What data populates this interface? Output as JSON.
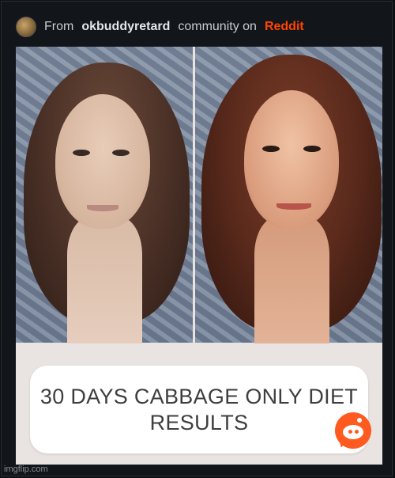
{
  "header": {
    "prefix": "From",
    "community": "okbuddyretard",
    "middle": "community on",
    "brand": "Reddit",
    "avatar_icon": "community-avatar"
  },
  "post": {
    "caption_line1": "30 DAYS CABBAGE ONLY DIET",
    "caption_line2": "RESULTS",
    "badge_icon": "reddit-snoo-icon"
  },
  "watermark": "imgflip.com",
  "colors": {
    "background": "#0e1113",
    "brand": "#ff4500",
    "caption_text": "#3e3e3e"
  }
}
